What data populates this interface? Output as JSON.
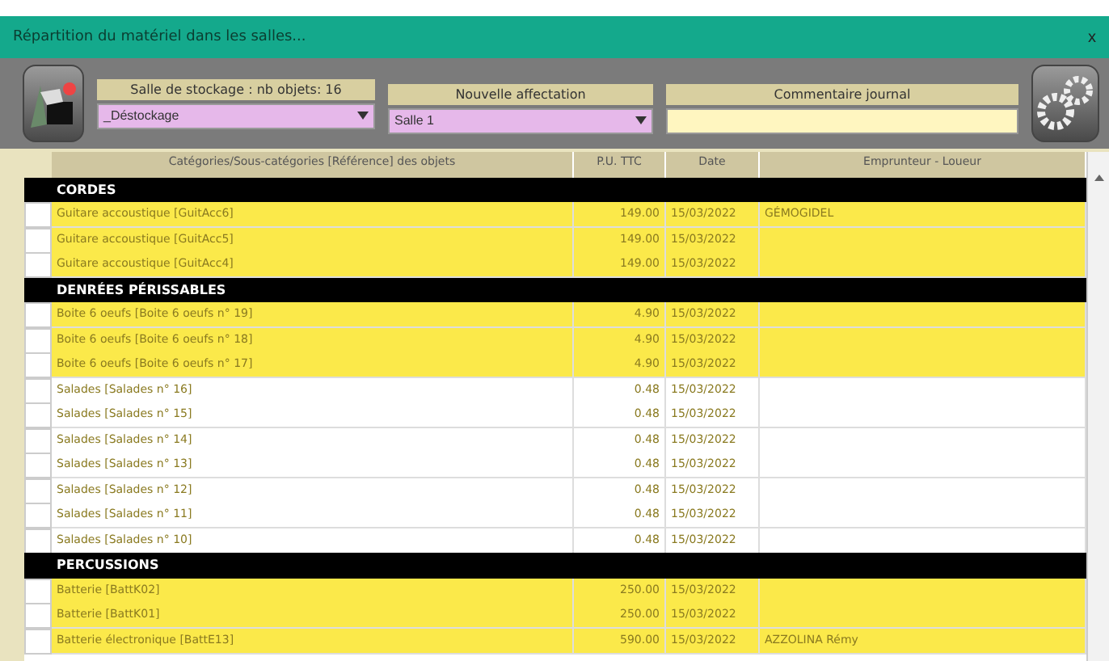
{
  "window": {
    "title": "Répartition du matériel dans les salles...",
    "close": "x"
  },
  "toolbar": {
    "storage_label": "Salle de stockage : nb objets: 16",
    "storage_value": "_Déstockage",
    "assign_label": "Nouvelle affectation",
    "assign_value": "Salle 1",
    "comment_label": "Commentaire journal"
  },
  "table": {
    "columns": [
      "Catégories/Sous-catégories [Référence] des objets",
      "P.U. TTC",
      "Date",
      "Emprunteur - Loueur"
    ],
    "rows": [
      {
        "kind": "category",
        "label": "CORDES"
      },
      {
        "kind": "item",
        "highlighted": true,
        "checked": false,
        "label": "Guitare accoustique [GuitAcc6]",
        "price": "149.00",
        "date": "15/03/2022",
        "borrower": "GÉMOGIDEL"
      },
      {
        "kind": "item",
        "highlighted": true,
        "checked": false,
        "label": "Guitare accoustique [GuitAcc5]",
        "price": "149.00",
        "date": "15/03/2022"
      },
      {
        "kind": "item",
        "highlighted": true,
        "checked": false,
        "label": "Guitare accoustique [GuitAcc4]",
        "price": "149.00",
        "date": "15/03/2022"
      },
      {
        "kind": "category",
        "label": "DENRÉES PÉRISSABLES"
      },
      {
        "kind": "item",
        "highlighted": true,
        "checked": false,
        "label": "Boite 6 oeufs [Boite 6 oeufs n° 19]",
        "price": "4.90",
        "date": "15/03/2022"
      },
      {
        "kind": "item",
        "highlighted": true,
        "checked": false,
        "label": "Boite 6 oeufs [Boite 6 oeufs n° 18]",
        "price": "4.90",
        "date": "15/03/2022"
      },
      {
        "kind": "item",
        "highlighted": true,
        "checked": false,
        "label": "Boite 6 oeufs [Boite 6 oeufs n° 17]",
        "price": "4.90",
        "date": "15/03/2022"
      },
      {
        "kind": "item",
        "highlighted": false,
        "checked": false,
        "label": "Salades [Salades n° 16]",
        "price": "0.48",
        "date": "15/03/2022"
      },
      {
        "kind": "item",
        "highlighted": false,
        "checked": false,
        "label": "Salades [Salades n° 15]",
        "price": "0.48",
        "date": "15/03/2022"
      },
      {
        "kind": "item",
        "highlighted": false,
        "checked": false,
        "label": "Salades [Salades n° 14]",
        "price": "0.48",
        "date": "15/03/2022"
      },
      {
        "kind": "item",
        "highlighted": false,
        "checked": false,
        "label": "Salades [Salades n° 13]",
        "price": "0.48",
        "date": "15/03/2022"
      },
      {
        "kind": "item",
        "highlighted": false,
        "checked": false,
        "label": "Salades [Salades n° 12]",
        "price": "0.48",
        "date": "15/03/2022"
      },
      {
        "kind": "item",
        "highlighted": false,
        "checked": false,
        "label": "Salades [Salades n° 11]",
        "price": "0.48",
        "date": "15/03/2022"
      },
      {
        "kind": "item",
        "highlighted": false,
        "checked": false,
        "label": "Salades [Salades n° 10]",
        "price": "0.48",
        "date": "15/03/2022"
      },
      {
        "kind": "category",
        "label": "PERCUSSIONS"
      },
      {
        "kind": "item",
        "highlighted": true,
        "checked": false,
        "label": "Batterie [BattK02]",
        "price": "250.00",
        "date": "15/03/2022"
      },
      {
        "kind": "item",
        "highlighted": true,
        "checked": false,
        "label": "Batterie [BattK01]",
        "price": "250.00",
        "date": "15/03/2022"
      },
      {
        "kind": "item",
        "highlighted": true,
        "checked": false,
        "label": "Batterie électronique [BattE13]",
        "price": "590.00",
        "date": "15/03/2022",
        "borrower": "AZZOLINA Rémy"
      }
    ]
  }
}
